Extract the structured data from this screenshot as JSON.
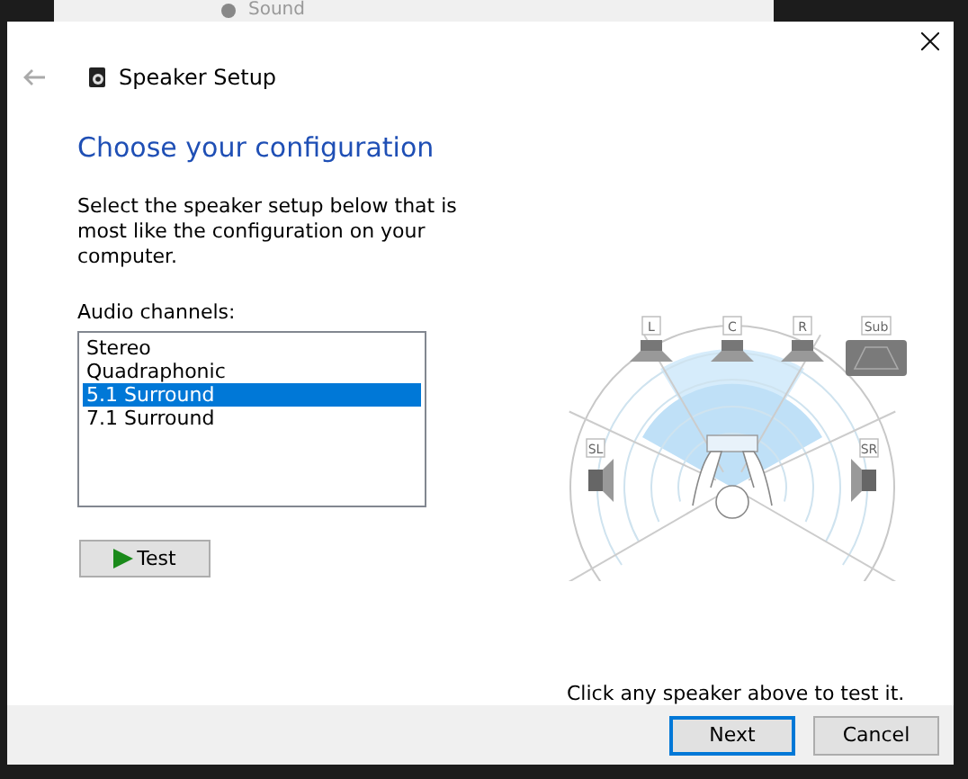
{
  "background_window": {
    "title": "Sound"
  },
  "dialog": {
    "title": "Speaker Setup",
    "heading": "Choose your configuration",
    "description": "Select the speaker setup below that is most like the configuration on your computer.",
    "list_label": "Audio channels:",
    "channels": [
      {
        "label": "Stereo",
        "selected": false
      },
      {
        "label": "Quadraphonic",
        "selected": false
      },
      {
        "label": "5.1 Surround",
        "selected": true
      },
      {
        "label": "7.1 Surround",
        "selected": false
      }
    ],
    "test_button": "Test",
    "speakers": [
      {
        "label": "L",
        "kind": "front"
      },
      {
        "label": "C",
        "kind": "front"
      },
      {
        "label": "R",
        "kind": "front"
      },
      {
        "label": "Sub",
        "kind": "sub"
      },
      {
        "label": "SL",
        "kind": "side"
      },
      {
        "label": "SR",
        "kind": "side"
      }
    ],
    "hint": "Click any speaker above to test it.",
    "buttons": [
      {
        "label": "Next",
        "default": true
      },
      {
        "label": "Cancel",
        "default": false
      }
    ]
  }
}
